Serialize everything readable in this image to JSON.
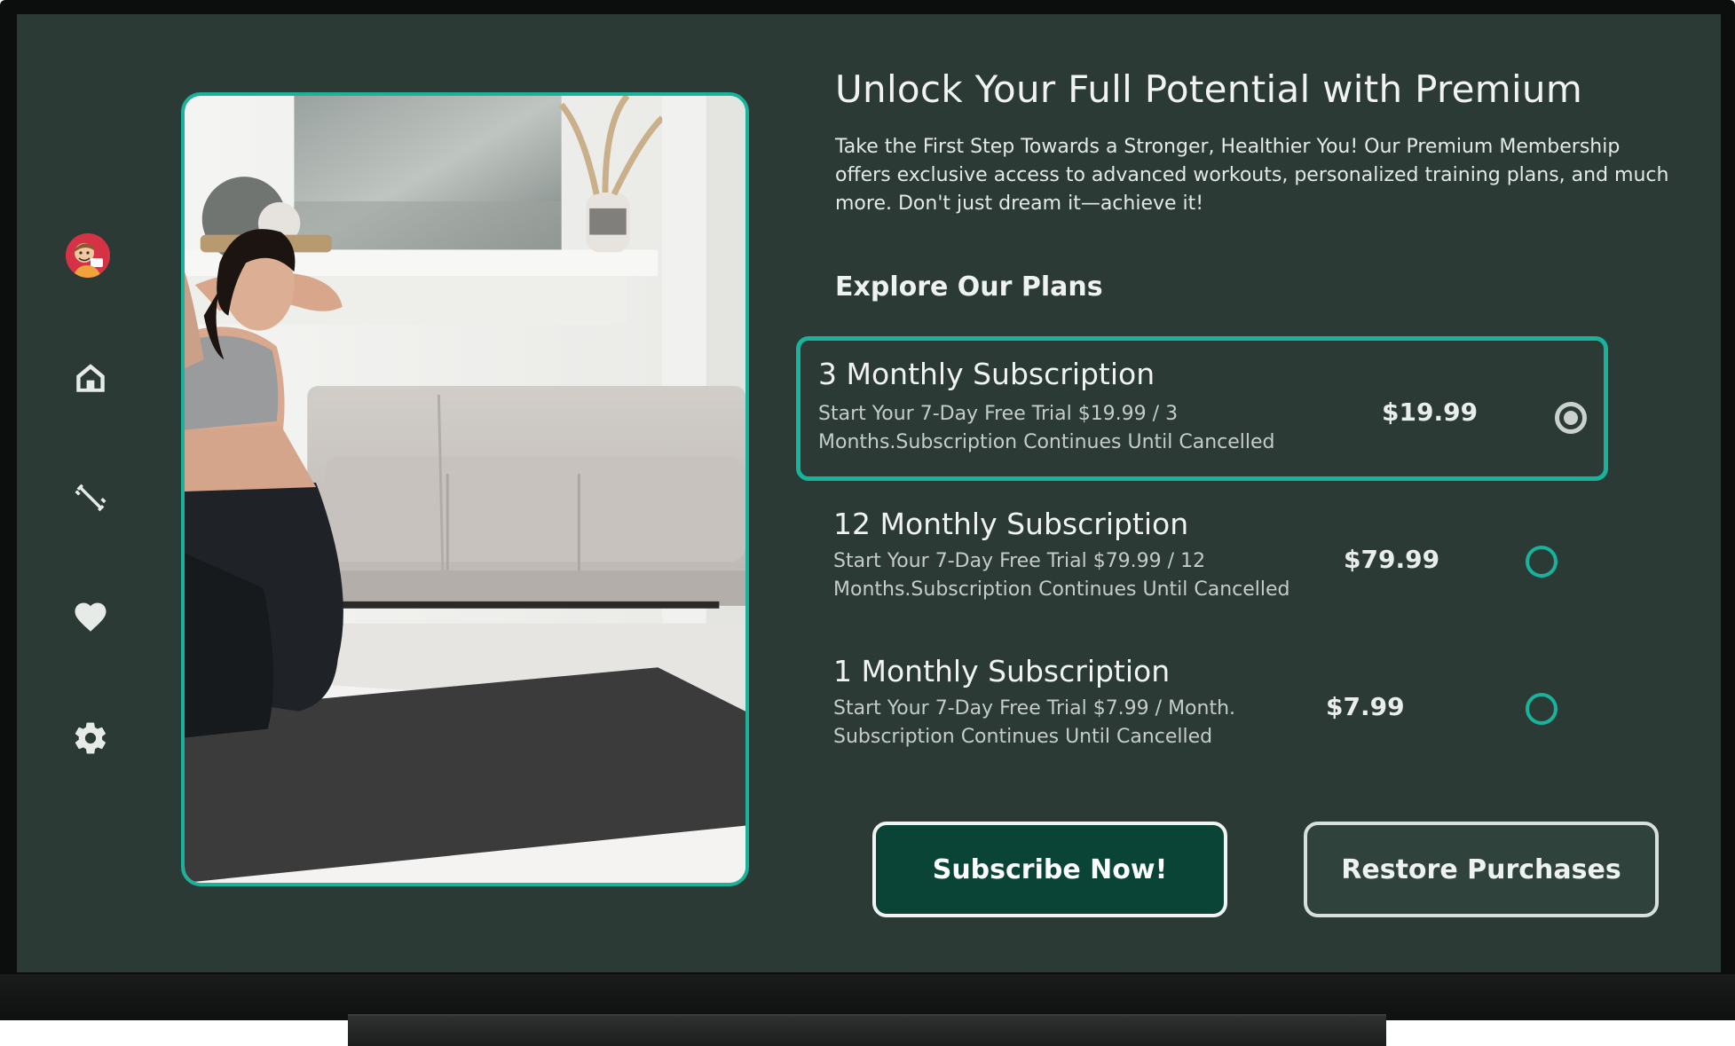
{
  "sidebar": {
    "items": [
      {
        "name": "profile",
        "icon": "avatar-icon"
      },
      {
        "name": "home",
        "icon": "home-icon"
      },
      {
        "name": "workouts",
        "icon": "dumbbell-icon"
      },
      {
        "name": "favorites",
        "icon": "heart-icon"
      },
      {
        "name": "settings",
        "icon": "gear-icon"
      }
    ]
  },
  "hero": {
    "title": "Unlock Your Full Potential with Premium",
    "description": "Take the First Step Towards a Stronger, Healthier You! Our Premium Membership offers exclusive access to advanced workouts, personalized training plans, and much more. Don't just dream it—achieve it!"
  },
  "plans": {
    "section_title": "Explore Our Plans",
    "selected_index": 0,
    "items": [
      {
        "name": "3 Monthly Subscription",
        "description": "Start Your 7-Day Free Trial $19.99 / 3 Months.Subscription Continues Until Cancelled",
        "price": "$19.99"
      },
      {
        "name": "12 Monthly Subscription",
        "description": "Start Your 7-Day Free Trial $79.99 / 12 Months.Subscription Continues Until Cancelled",
        "price": "$79.99"
      },
      {
        "name": "1 Monthly Subscription",
        "description": "Start Your 7-Day Free Trial $7.99 / Month. Subscription Continues Until Cancelled",
        "price": "$7.99"
      }
    ]
  },
  "actions": {
    "subscribe_label": "Subscribe Now!",
    "restore_label": "Restore Purchases"
  },
  "colors": {
    "background": "#2b3a35",
    "accent": "#19b39c",
    "primary_button": "#0a4436"
  }
}
